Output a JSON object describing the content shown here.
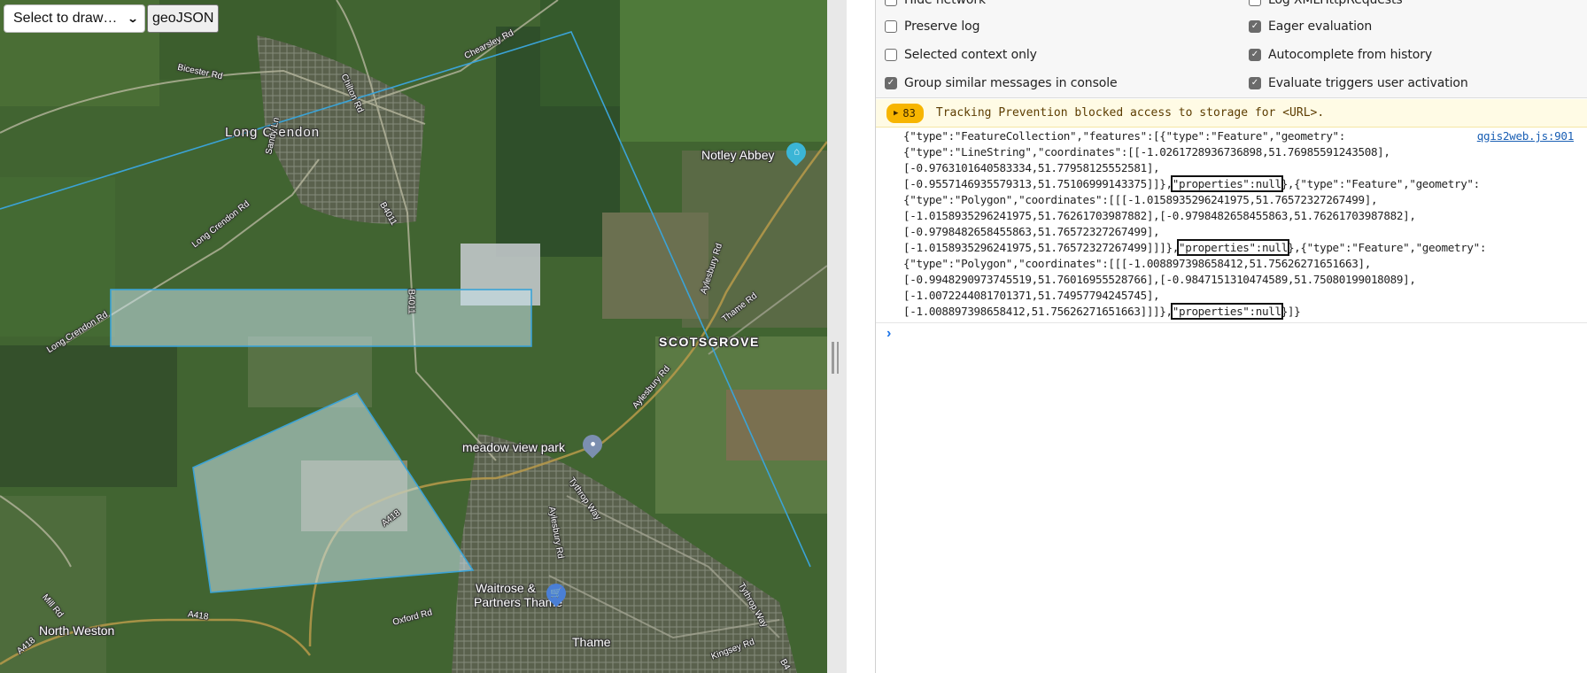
{
  "map": {
    "draw_select": {
      "value": "Select to draw…"
    },
    "geojson_button": "geoJSON",
    "labels": {
      "long_crendon": "Long Crendon",
      "chearsley_rd": "Chearsley Rd",
      "bicester_rd": "Bicester Rd",
      "chilton_rd": "Chilton Rd",
      "sandy_ln": "Sandy Ln",
      "long_crendon_rd_1": "Long Crendon Rd",
      "long_crendon_rd_2": "Long Crendon Rd",
      "b4011_1": "B4011",
      "b4011_2": "B4011",
      "notley_abbey": "Notley Abbey",
      "aylesbury_rd_1": "Aylesbury Rd",
      "aylesbury_rd_2": "Aylesbury Rd",
      "aylesbury_rd_3": "Aylesbury Rd",
      "thame_rd": "Thame Rd",
      "scotsgrove": "SCOTSGROVE",
      "meadow_view_park": "meadow view park",
      "tythrop_way_1": "Tythrop Way",
      "tythrop_way_2": "Tythrop Way",
      "a418_1": "A418",
      "a418_2": "A418",
      "a418_3": "A418",
      "waitrose_1": "Waitrose &",
      "waitrose_2": "Partners Thame",
      "mill_rd": "Mill Rd",
      "north_weston": "North Weston",
      "oxford_rd": "Oxford Rd",
      "thame": "Thame",
      "kingsey_rd": "Kingsey Rd",
      "b4": "B4"
    },
    "colors": {
      "feature_stroke": "#3ba3d6",
      "feature_fill": "rgba(200,225,235,0.55)"
    }
  },
  "devtools": {
    "settings_left": [
      {
        "label": "Hide network",
        "checked": false
      },
      {
        "label": "Preserve log",
        "checked": false
      },
      {
        "label": "Selected context only",
        "checked": false
      },
      {
        "label": "Group similar messages in console",
        "checked": true
      }
    ],
    "settings_right": [
      {
        "label": "Log XMLHttpRequests",
        "checked": false
      },
      {
        "label": "Eager evaluation",
        "checked": true
      },
      {
        "label": "Autocomplete from history",
        "checked": true
      },
      {
        "label": "Evaluate triggers user activation",
        "checked": true
      }
    ],
    "warning": {
      "count": "83",
      "message": "Tracking Prevention blocked access to storage for <URL>."
    },
    "log": {
      "source": "qgis2web.js:901",
      "lines": [
        [
          "{\"type\":\"FeatureCollection\",\"features\":[{\"type\":\"Feature\",\"geometry\":"
        ],
        [
          "{\"type\":\"LineString\",\"coordinates\":[[-1.0261728936736898,51.76985591243508],"
        ],
        [
          "[-0.9763101640583334,51.77958125552581],"
        ],
        [
          "[-0.9557146935579313,51.75106999143375]]},",
          "\"properties\":null",
          "},{\"type\":\"Feature\",\"geometry\":"
        ],
        [
          "{\"type\":\"Polygon\",\"coordinates\":[[[-1.0158935296241975,51.76572327267499],"
        ],
        [
          "[-1.0158935296241975,51.76261703987882],[-0.9798482658455863,51.76261703987882],"
        ],
        [
          "[-0.9798482658455863,51.76572327267499],"
        ],
        [
          "[-1.0158935296241975,51.76572327267499]]]},",
          "\"properties\":null",
          "},{\"type\":\"Feature\",\"geometry\":"
        ],
        [
          "{\"type\":\"Polygon\",\"coordinates\":[[[-1.008897398658412,51.75626271651663],"
        ],
        [
          "[-0.9948290973745519,51.76016955528766],[-0.9847151310474589,51.75080199018089],"
        ],
        [
          "[-1.0072244081701371,51.74957794245745],"
        ],
        [
          "[-1.008897398658412,51.75626271651663]]]},",
          "\"properties\":null",
          "}]}"
        ]
      ]
    },
    "prompt_symbol": "›"
  }
}
